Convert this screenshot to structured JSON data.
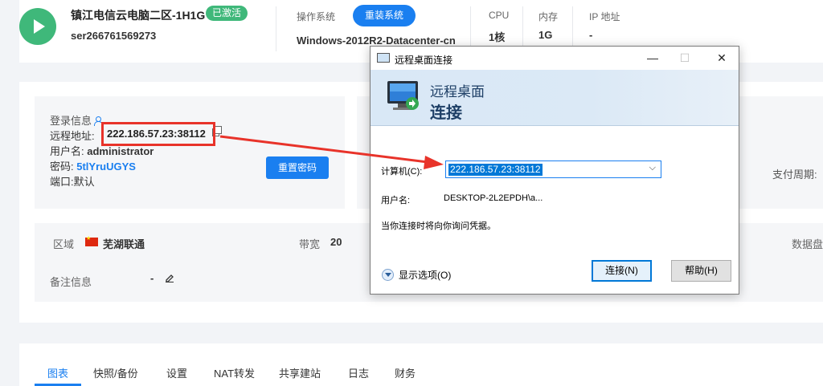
{
  "server": {
    "name": "镇江电信云电脑二区-1H1G",
    "status_badge": "已激活",
    "id": "ser266761569273",
    "os_label": "操作系统",
    "reinstall_label": "重装系统",
    "os_value": "Windows-2012R2-Datacenter-cn",
    "specs": [
      {
        "label": "CPU",
        "value": "1核"
      },
      {
        "label": "内存",
        "value": "1G"
      },
      {
        "label": "IP 地址",
        "value": "-"
      }
    ]
  },
  "login": {
    "heading": "登录信息",
    "addr_label": "远程地址:",
    "addr_value": "222.186.57.23:38112",
    "user_label": "用户名:",
    "user_value": "administrator",
    "password_label": "密码:",
    "password_value": "5tlYruUGYS",
    "port_label": "端口:",
    "port_value": "默认",
    "reset_label": "重置密码",
    "cycle_label": "支付周期:"
  },
  "region": {
    "region_label": "区域",
    "region_value": "芜湖联通",
    "bandwidth_label": "带宽",
    "bandwidth_value": "20",
    "disk_label": "数据盘",
    "note_label": "备注信息",
    "note_value": "-"
  },
  "tabs": [
    "图表",
    "快照/备份",
    "设置",
    "NAT转发",
    "共享建站",
    "日志",
    "财务"
  ],
  "dialog": {
    "title": "远程桌面连接",
    "minimize": "—",
    "maximize": "☐",
    "close": "✕",
    "banner_line1": "远程桌面",
    "banner_line2": "连接",
    "computer_label": "计算机(C):",
    "computer_value": "222.186.57.23:38112",
    "username_label": "用户名:",
    "username_value": "DESKTOP-2L2EPDH\\a...",
    "note": "当你连接时将向你询问凭据。",
    "show_options": "显示选项(O)",
    "connect_label": "连接(N)",
    "help_label": "帮助(H)"
  },
  "colors": {
    "accent": "#1a7ff0",
    "active_green": "#3fb87a",
    "annotation_red": "#e8332a"
  }
}
